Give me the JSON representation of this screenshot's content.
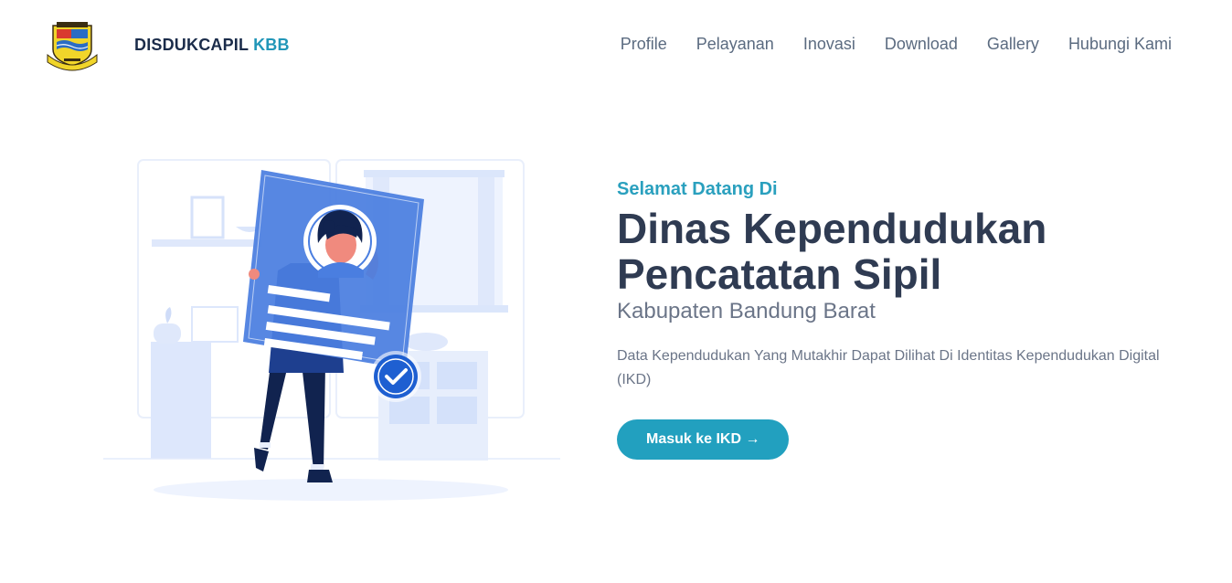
{
  "brand": {
    "name": "DISDUKCAPIL",
    "accent": "KBB"
  },
  "nav": {
    "items": [
      "Profile",
      "Pelayanan",
      "Inovasi",
      "Download",
      "Gallery",
      "Hubungi Kami"
    ]
  },
  "hero": {
    "eyebrow": "Selamat Datang Di",
    "title_line1": "Dinas Kependudukan",
    "title_line2": "Pencatatan Sipil",
    "subtitle": "Kabupaten Bandung Barat",
    "description": "Data Kependudukan Yang Mutakhir Dapat Dilihat Di Identitas Kependudukan Digital (IKD)",
    "cta_label": "Masuk ke IKD →"
  },
  "colors": {
    "accent": "#22a0bf",
    "heading": "#2f3b52",
    "illustration_blue": "#4a7ee0"
  },
  "icons": {
    "logo": "kbb-coat-of-arms",
    "check": "check-circle-icon"
  }
}
